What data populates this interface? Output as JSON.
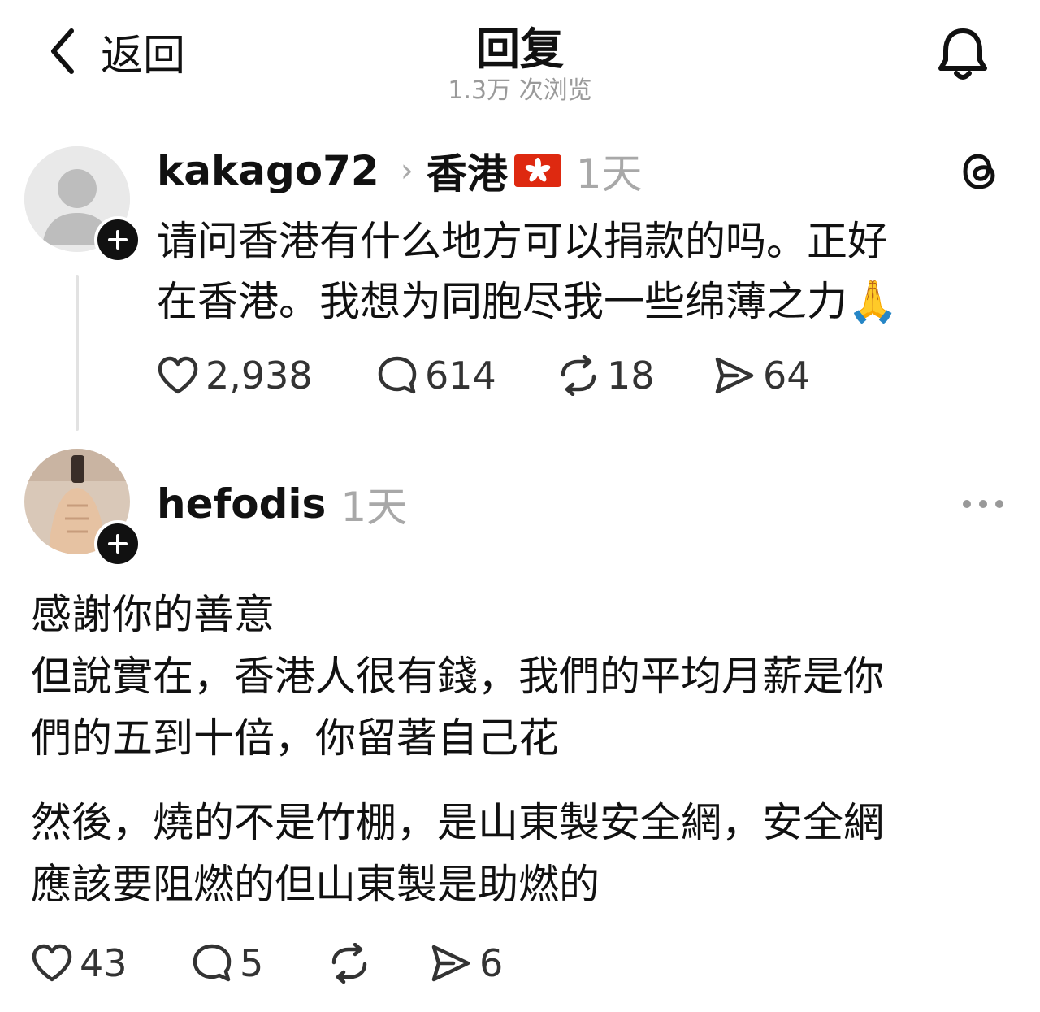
{
  "header": {
    "back_label": "返回",
    "title": "回复",
    "views": "1.3万 次浏览"
  },
  "post": {
    "username": "kakago72",
    "location": "香港",
    "time": "1天",
    "body_line1": "请问香港有什么地方可以捐款的吗。正好",
    "body_line2": "在香港。我想为同胞尽我一些绵薄之力",
    "emoji": "🙏",
    "likes": "2,938",
    "comments": "614",
    "reposts": "18",
    "shares": "64"
  },
  "reply": {
    "username": "hefodis",
    "time": "1天",
    "para1": "感謝你的善意",
    "para2_line1": "但說實在，香港人很有錢，我們的平均月薪是你",
    "para2_line2": "們的五到十倍，你留著自己花",
    "para3_line1": "然後，燒的不是竹棚，是山東製安全網，安全網",
    "para3_line2": "應該要阻燃的但山東製是助燃的",
    "likes": "43",
    "comments": "5",
    "shares": "6"
  },
  "colors": {
    "text": "#111111",
    "muted": "#a8a8a8",
    "flag_red": "#de2910"
  }
}
